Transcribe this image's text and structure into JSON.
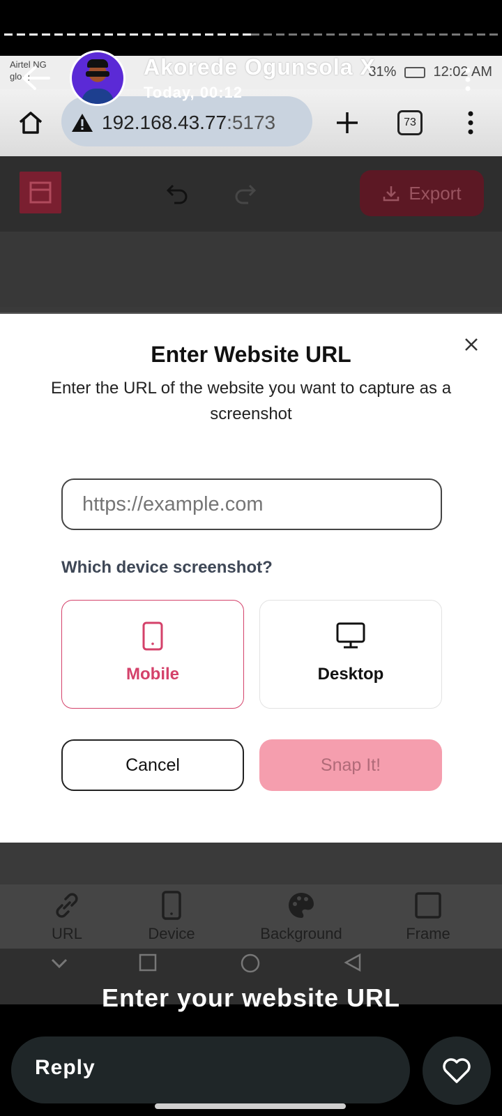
{
  "status_bar": {
    "carrier_line1": "Airtel NG",
    "carrier_line2": "glo·g",
    "battery_text": "31%",
    "time": "12:02 AM"
  },
  "story": {
    "author": "Akorede Ogunsola X",
    "timestamp": "Today, 00:12",
    "caption": "Enter your website URL",
    "reply_label": "Reply"
  },
  "browser": {
    "url_host": "192.168.43.77",
    "url_port": ":5173",
    "tab_count": "73"
  },
  "app_toolbar": {
    "export_label": "Export"
  },
  "modal": {
    "title": "Enter Website URL",
    "subtitle": "Enter the URL of the website you want to capture as a screenshot",
    "url_input": {
      "value": "",
      "placeholder": "https://example.com"
    },
    "device_question": "Which device screenshot?",
    "devices": [
      {
        "label": "Mobile",
        "selected": true
      },
      {
        "label": "Desktop",
        "selected": false
      }
    ],
    "cancel_label": "Cancel",
    "snap_label": "Snap It!"
  },
  "bottom_tabs": [
    {
      "label": "URL",
      "icon": "link-icon"
    },
    {
      "label": "Device",
      "icon": "phone-icon"
    },
    {
      "label": "Background",
      "icon": "palette-icon"
    },
    {
      "label": "Frame",
      "icon": "square-icon"
    }
  ],
  "colors": {
    "accent": "#d4416a",
    "snap_button_disabled": "#f59eae",
    "export_button": "#5c1824"
  }
}
